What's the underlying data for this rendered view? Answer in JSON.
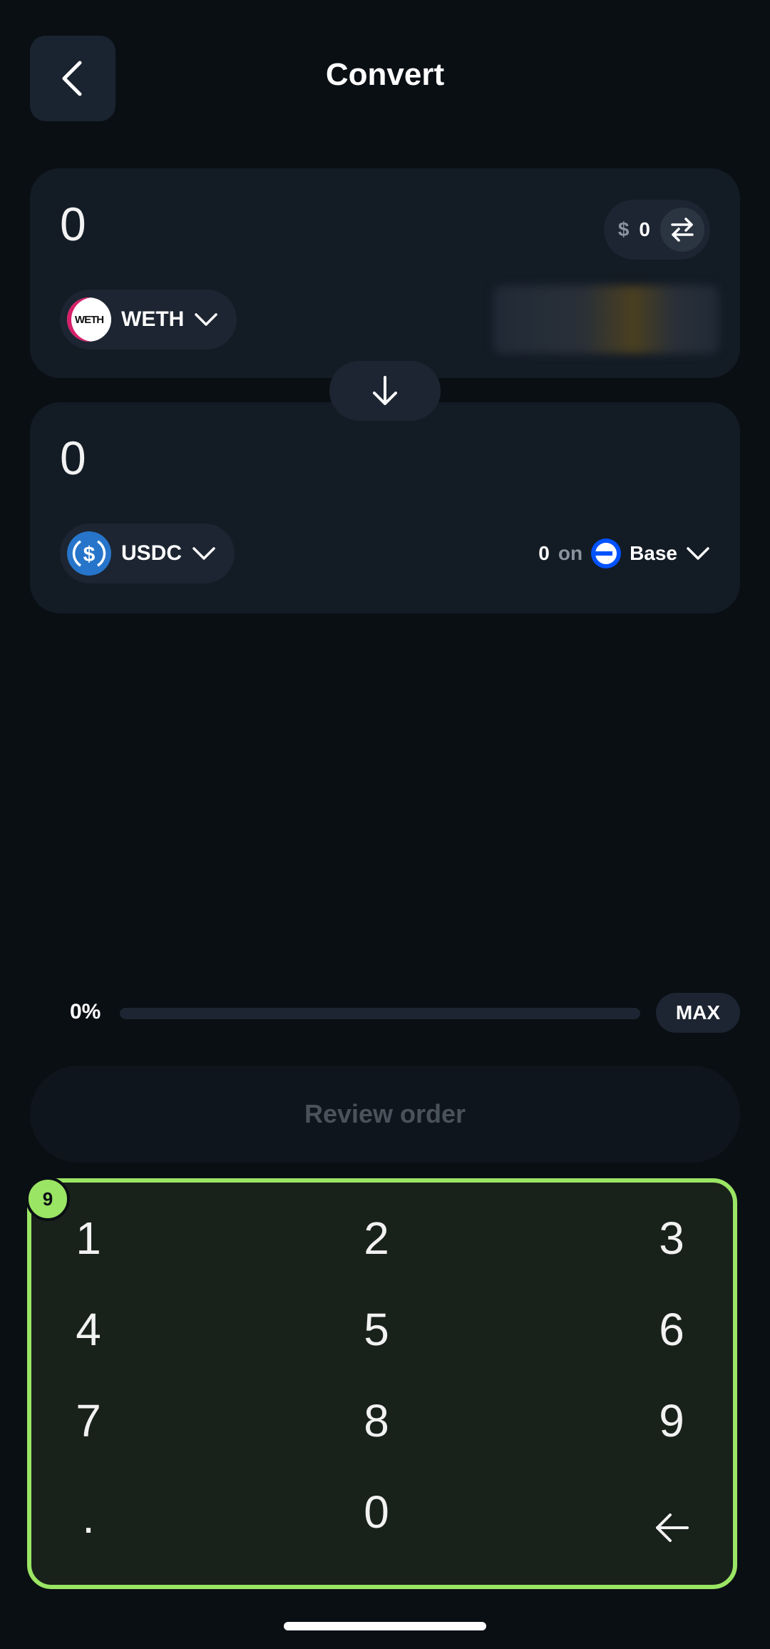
{
  "header": {
    "title": "Convert"
  },
  "from": {
    "amount": "0",
    "fiat_symbol": "$",
    "fiat_value": "0",
    "token": {
      "symbol": "WETH",
      "logo_text": "WETH"
    }
  },
  "to": {
    "amount": "0",
    "token": {
      "symbol": "USDC"
    },
    "balance": "0",
    "on_label": "on",
    "network": "Base"
  },
  "progress": {
    "percent_label": "0%",
    "value": 0,
    "max_label": "MAX"
  },
  "review": {
    "label": "Review order"
  },
  "keypad": {
    "badge": "9",
    "keys": [
      "1",
      "2",
      "3",
      "4",
      "5",
      "6",
      "7",
      "8",
      "9",
      ".",
      "0"
    ]
  },
  "colors": {
    "accent_green": "#9be564",
    "background": "#0a0f14",
    "card": "#131b25",
    "usdc_blue": "#2775ca",
    "base_blue": "#0052ff",
    "weth_pink": "#d61f69"
  },
  "icons": {
    "back": "chevron-left-icon",
    "swap": "swap-horizontal-icon",
    "direction": "arrow-down-icon",
    "dropdown": "chevron-down-icon",
    "backspace": "arrow-left-icon"
  }
}
